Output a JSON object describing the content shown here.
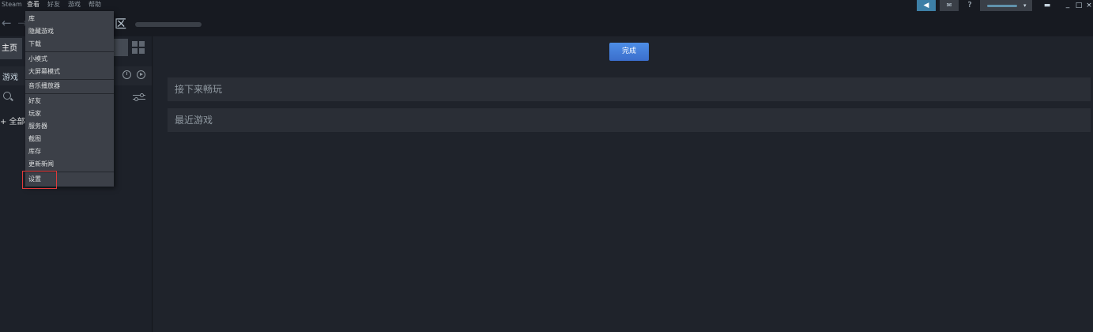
{
  "menubar": {
    "items": [
      "Steam",
      "查看",
      "好友",
      "游戏",
      "帮助"
    ],
    "active_index": 1
  },
  "window_controls": {
    "help": "?",
    "minimize": "_",
    "maximize": "□",
    "close": "×"
  },
  "nav": {
    "back_icon": "arrow-left-icon",
    "forward_icon": "arrow-right-icon",
    "tab_fragment": "区"
  },
  "sidebar": {
    "home_label": "主页",
    "games_label": "游戏",
    "all_label": "+ 全部"
  },
  "main": {
    "done_label": "完成",
    "shelves": [
      "接下来畅玩",
      "最近游戏"
    ]
  },
  "dropdown": {
    "groups": [
      [
        "库",
        "隐藏游戏",
        "下载"
      ],
      [
        "小模式",
        "大屏幕模式"
      ],
      [
        "音乐播放器"
      ],
      [
        "好友",
        "玩家",
        "服务器",
        "截图",
        "库存",
        "更新新闻"
      ],
      [
        "设置"
      ]
    ],
    "highlighted_item": "设置"
  },
  "colors": {
    "background": "#1b1f27",
    "accent": "#3d7fa6",
    "done_button": "#4d8ee6",
    "highlight_box": "#e03b3b"
  }
}
